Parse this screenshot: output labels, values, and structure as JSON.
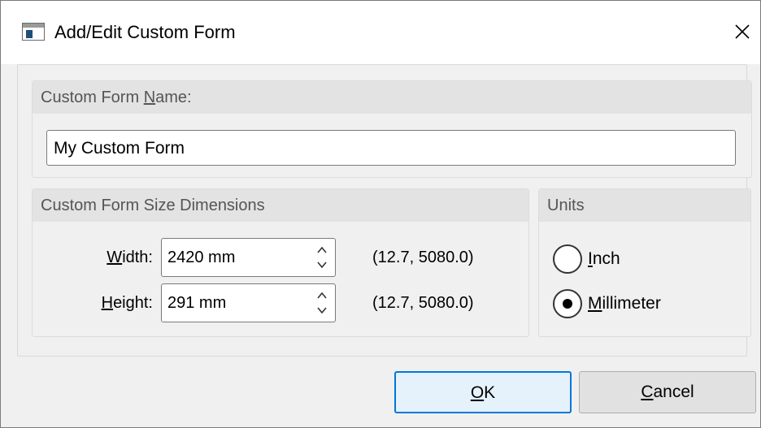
{
  "window": {
    "title": "Add/Edit Custom Form"
  },
  "name_group": {
    "header_pre": "Custom Form ",
    "header_accel": "N",
    "header_post": "ame:",
    "value": "My Custom Form"
  },
  "size_group": {
    "header": "Custom Form Size Dimensions",
    "width": {
      "accel": "W",
      "label_rest": "idth:",
      "value": "2420 mm",
      "range": "(12.7, 5080.0)"
    },
    "height": {
      "accel": "H",
      "label_rest": "eight:",
      "value": "291 mm",
      "range": "(12.7, 5080.0)"
    }
  },
  "units_group": {
    "header": "Units",
    "options": [
      {
        "accel": "I",
        "rest": "nch",
        "selected": false
      },
      {
        "accel": "M",
        "rest": "illimeter",
        "selected": true
      }
    ]
  },
  "buttons": {
    "ok": {
      "accel": "O",
      "rest": "K"
    },
    "cancel": {
      "accel": "C",
      "rest": "ancel"
    }
  },
  "icons": {
    "app": "form-icon",
    "close": "close-icon",
    "spin": "spin-arrows-icon"
  }
}
